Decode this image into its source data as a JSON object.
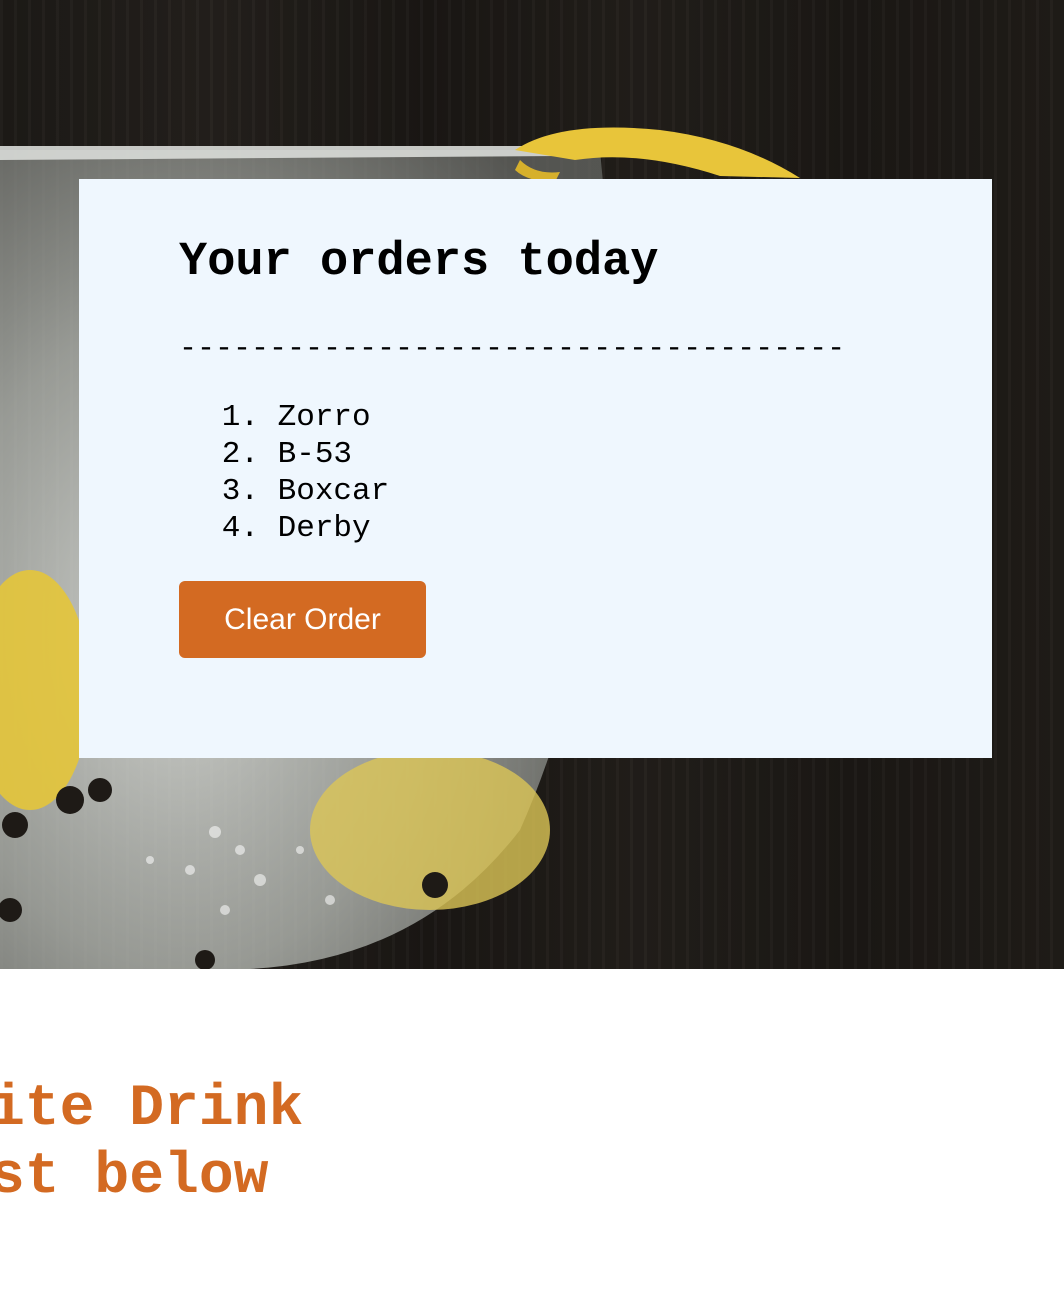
{
  "hero": {
    "image": "cocktail-glass-with-lemon-peel",
    "colors": {
      "background": "#1f1b18",
      "lemon": "#e8c53a"
    }
  },
  "order_card": {
    "title": "Your orders today",
    "divider": "-------------------------------------",
    "orders": [
      {
        "number": "1.",
        "name": "Zorro"
      },
      {
        "number": "2.",
        "name": "B-53"
      },
      {
        "number": "3.",
        "name": "Boxcar"
      },
      {
        "number": "4.",
        "name": "Derby"
      }
    ],
    "clear_button_label": "Clear Order",
    "colors": {
      "card_background": "#eff7fe",
      "button_background": "#d36a22",
      "button_text": "#ffffff"
    }
  },
  "section": {
    "heading_line1": "ite Drink",
    "heading_line2": "st below",
    "color": "#d36a22"
  }
}
